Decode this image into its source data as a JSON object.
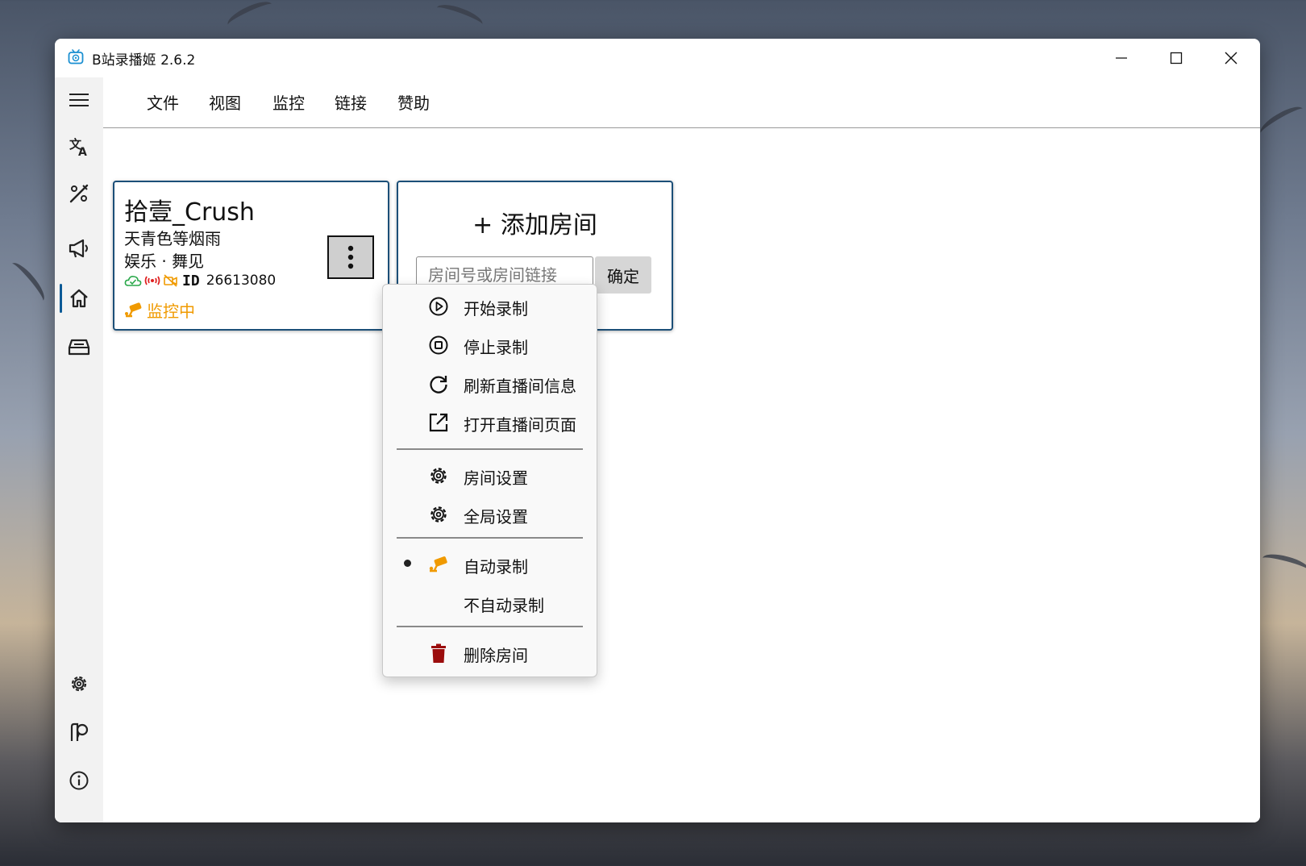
{
  "window": {
    "title": "B站录播姬 2.6.2"
  },
  "menubar": {
    "items": [
      "文件",
      "视图",
      "监控",
      "链接",
      "赞助"
    ]
  },
  "room_card": {
    "name": "拾壹_Crush",
    "title": "天青色等烟雨",
    "area": "娱乐 · 舞见",
    "id_label": "ID",
    "room_id": "26613080",
    "monitor_status": "监控中",
    "status_colors": {
      "cloud": "#2aa84a",
      "live": "#e02020",
      "record": "#f09a00",
      "monitor": "#f09a00"
    }
  },
  "add_card": {
    "title": "+ 添加房间",
    "input_placeholder": "房间号或房间链接",
    "input_value": "",
    "confirm_label": "确定"
  },
  "context_menu": {
    "items": [
      {
        "icon": "play-circle-icon",
        "label": "开始录制"
      },
      {
        "icon": "stop-circle-icon",
        "label": "停止录制"
      },
      {
        "icon": "refresh-icon",
        "label": "刷新直播间信息"
      },
      {
        "icon": "open-external-icon",
        "label": "打开直播间页面"
      },
      {
        "icon": "gear-icon",
        "label": "房间设置"
      },
      {
        "icon": "gear-icon",
        "label": "全局设置"
      },
      {
        "icon": "camera-icon",
        "label": "自动录制",
        "selected": true
      },
      {
        "icon": "",
        "label": "不自动录制"
      },
      {
        "icon": "trash-icon",
        "label": "删除房间"
      }
    ],
    "accent_delete": "#9b0d0d"
  },
  "sidebar": {
    "active": "home",
    "top_items": [
      "menu-icon",
      "translate-icon",
      "toolbox-icon",
      "announcement-icon",
      "home-icon",
      "tray-icon"
    ],
    "bottom_items": [
      "gear-icon",
      "feedback-icon",
      "info-icon"
    ]
  }
}
